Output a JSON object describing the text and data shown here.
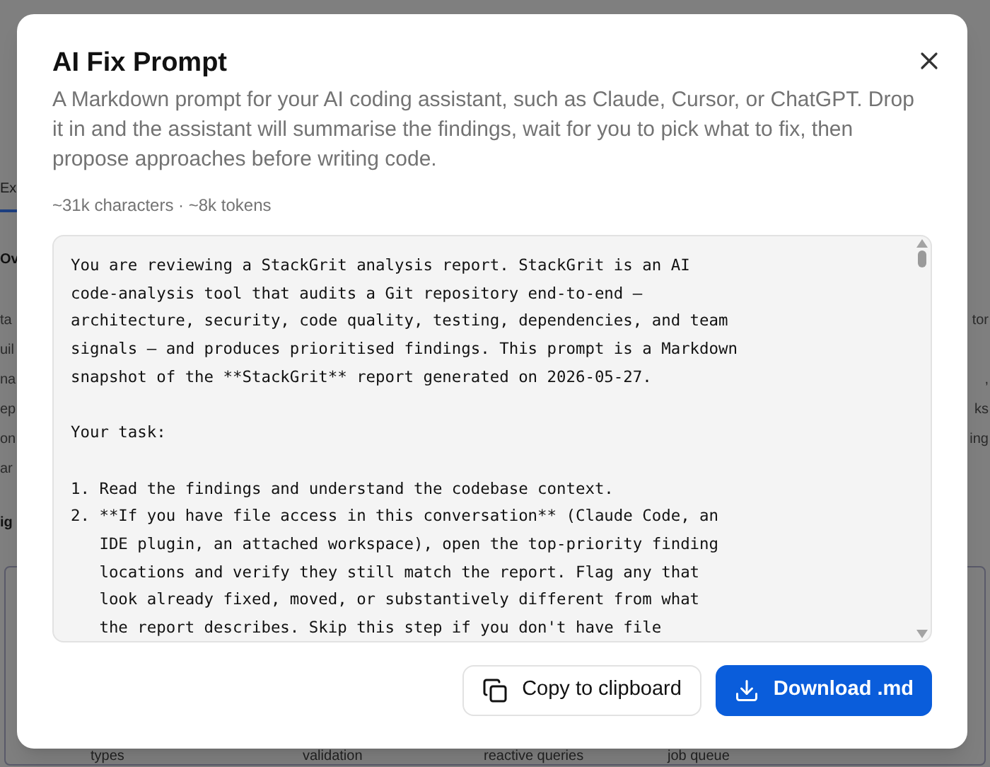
{
  "background": {
    "tab": "Ex",
    "heading": "Ov",
    "text_rows": [
      {
        "left": "ta",
        "right": "tor"
      },
      {
        "left": "uil"
      },
      {
        "left": "na",
        "right": ","
      },
      {
        "left": "ep",
        "right": "ks"
      },
      {
        "left": "on",
        "right": "ing"
      },
      {
        "left": "ar"
      }
    ],
    "section_heading": "ig",
    "diagram_labels": [
      "types",
      "validation",
      "reactive queries",
      "job queue"
    ]
  },
  "dialog": {
    "title": "AI Fix Prompt",
    "description": "A Markdown prompt for your AI coding assistant, such as Claude, Cursor, or ChatGPT. Drop it in and the assistant will summarise the findings, wait for you to pick what to fix, then propose approaches before writing code.",
    "stats": "~31k characters · ~8k tokens",
    "prompt": "You are reviewing a StackGrit analysis report. StackGrit is an AI\ncode-analysis tool that audits a Git repository end-to-end —\narchitecture, security, code quality, testing, dependencies, and team\nsignals — and produces prioritised findings. This prompt is a Markdown\nsnapshot of the **StackGrit** report generated on 2026-05-27.\n\nYour task:\n\n1. Read the findings and understand the codebase context.\n2. **If you have file access in this conversation** (Claude Code, an\n   IDE plugin, an attached workspace), open the top-priority finding\n   locations and verify they still match the report. Flag any that\n   look already fixed, moved, or substantively different from what\n   the report describes. Skip this step if you don't have file",
    "buttons": [
      {
        "kind": "secondary",
        "label": "Copy to clipboard"
      },
      {
        "kind": "primary",
        "label": "Download .md"
      }
    ]
  }
}
